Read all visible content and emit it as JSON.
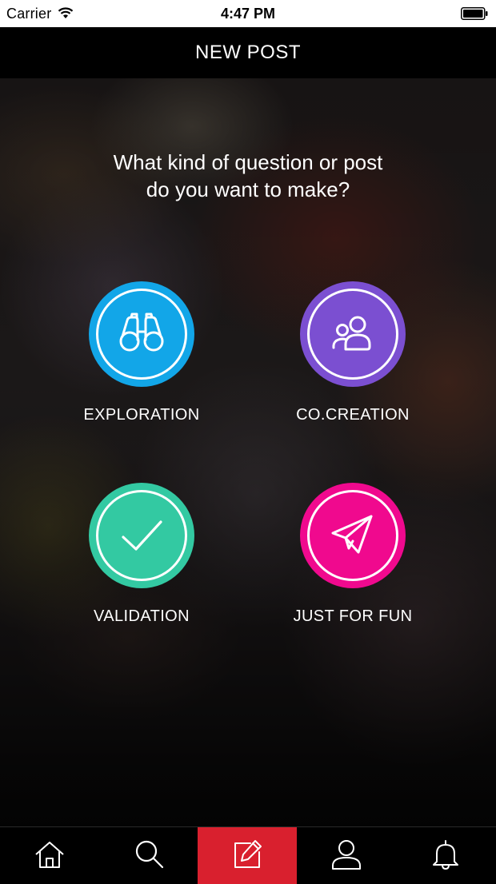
{
  "status_bar": {
    "carrier": "Carrier",
    "time": "4:47 PM",
    "icons": [
      "wifi-icon",
      "battery-icon"
    ]
  },
  "nav": {
    "title": "NEW POST"
  },
  "prompt": {
    "line1": "What kind of question or post",
    "line2": "do you want to make?"
  },
  "options": [
    {
      "label": "EXPLORATION",
      "icon": "binoculars-icon",
      "color": "#12A6E8"
    },
    {
      "label": "CO.CREATION",
      "icon": "people-icon",
      "color": "#7B4FD1"
    },
    {
      "label": "VALIDATION",
      "icon": "checkmark-icon",
      "color": "#33C9A2"
    },
    {
      "label": "JUST FOR FUN",
      "icon": "paper-plane-icon",
      "color": "#F0098E"
    }
  ],
  "tab_bar": {
    "tabs": [
      {
        "name": "home",
        "icon": "home-icon",
        "active": false
      },
      {
        "name": "search",
        "icon": "search-icon",
        "active": false
      },
      {
        "name": "compose",
        "icon": "compose-icon",
        "active": true
      },
      {
        "name": "profile",
        "icon": "profile-icon",
        "active": false
      },
      {
        "name": "notifications",
        "icon": "bell-icon",
        "active": false
      }
    ],
    "active_color": "#D9202E"
  }
}
